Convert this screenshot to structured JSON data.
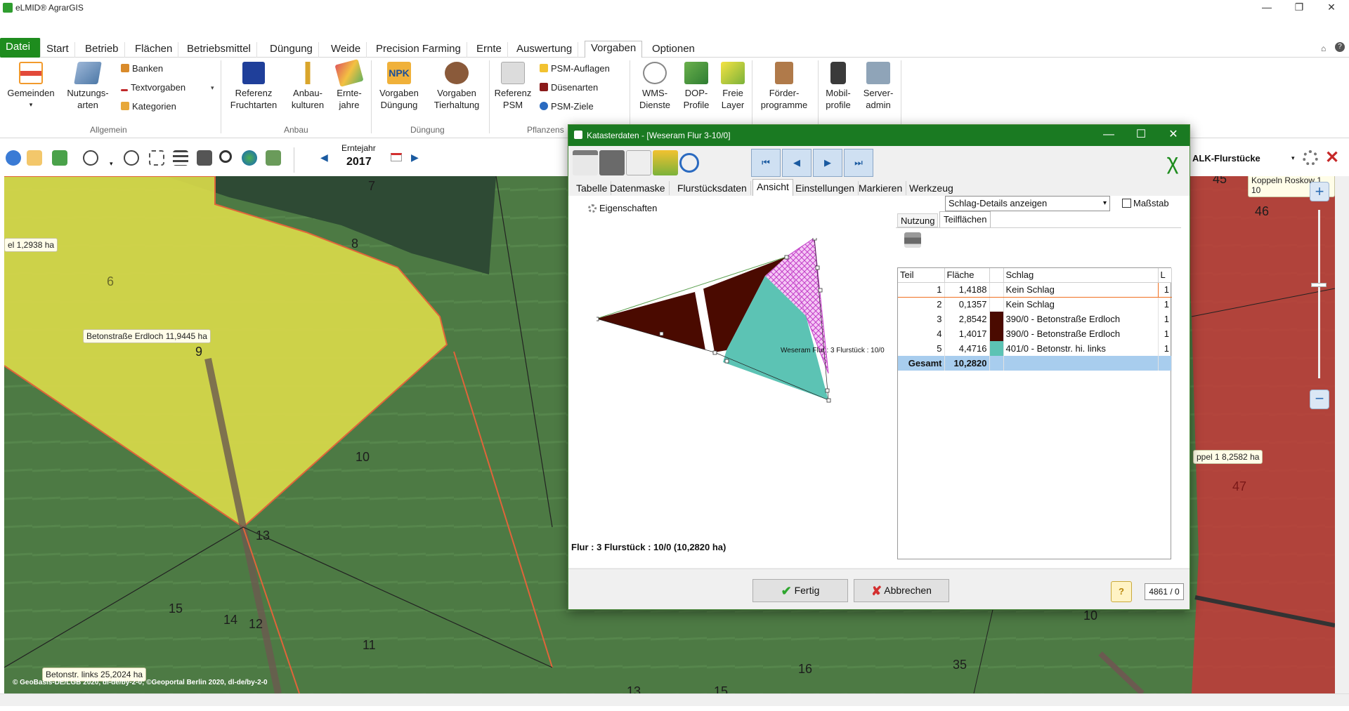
{
  "app": {
    "title": "eLMID® AgrarGIS"
  },
  "menu": {
    "tabs": [
      "Datei",
      "Start",
      "Betrieb",
      "Flächen",
      "Betriebsmittel",
      "Düngung",
      "Weide",
      "Precision Farming",
      "Ernte",
      "Auswertung",
      "Vorgaben",
      "Optionen"
    ],
    "active": "Vorgaben"
  },
  "ribbon": {
    "gemeinden": "Gemeinden",
    "nutzungsarten": [
      "Nutzungs-",
      "arten"
    ],
    "banken": "Banken",
    "textvorgaben": "Textvorgaben",
    "kategorien": "Kategorien",
    "group_allgemein": "Allgemein",
    "referenz_fruchtarten": [
      "Referenz",
      "Fruchtarten"
    ],
    "anbaukulturen": [
      "Anbau-",
      "kulturen"
    ],
    "erntejahre": [
      "Ernte-",
      "jahre"
    ],
    "group_anbau": "Anbau",
    "vorgaben_duengung": [
      "Vorgaben",
      "Düngung"
    ],
    "vorgaben_tierhaltung": [
      "Vorgaben",
      "Tierhaltung"
    ],
    "group_duengung": "Düngung",
    "referenz_psm": [
      "Referenz",
      "PSM"
    ],
    "psm_auflagen": "PSM-Auflagen",
    "duesenarten": "Düsenarten",
    "psm_ziele": "PSM-Ziele",
    "group_pflanzenschutz": "Pflanzens",
    "wms_dienste": [
      "WMS-",
      "Dienste"
    ],
    "dop_profile": [
      "DOP-",
      "Profile"
    ],
    "freie_layer": [
      "Freie",
      "Layer"
    ],
    "foerderprogramme": [
      "Förder-",
      "programme"
    ],
    "mobilprofile": [
      "Mobil-",
      "profile"
    ],
    "serveradmin": [
      "Server-",
      "admin"
    ],
    "npk_badge": "NPK"
  },
  "toolbar": {
    "erntejahr_label": "Erntejahr",
    "erntejahr_value": "2017",
    "alk_label": "ALK-Flurstücke"
  },
  "map": {
    "labels": {
      "l1": "el 1,2938 ha",
      "l2": "Betonstraße Erdloch 11,9445 ha",
      "l3": "Betonstr. links 25,2024 ha",
      "l4": "ppel 1 8,2582 ha",
      "l5": "Koppeln Roskow 1 10"
    },
    "numbers": [
      "7",
      "8",
      "9",
      "10",
      "13",
      "15",
      "14",
      "12",
      "11",
      "16",
      "10",
      "35",
      "46",
      "47",
      "45",
      "13",
      "15",
      "6"
    ],
    "copyright": "© GeoBasis-DE/LGB 2020, dl-de/by-2-0; ©Geoportal Berlin 2020, dl-de/by-2-0"
  },
  "dialog": {
    "title": "Katasterdaten - [Weseram  Flur 3-10/0]",
    "tabs": [
      "Tabelle",
      "Datenmaske",
      "Flurstücksdaten",
      "Ansicht",
      "Einstellungen",
      "Markieren",
      "Werkzeug"
    ],
    "active_tab": "Ansicht",
    "eigenschaften": "Eigenschaften",
    "view_select": "Schlag-Details anzeigen",
    "massstab": "Maßstab",
    "subtabs": [
      "Nutzung",
      "Teilflächen"
    ],
    "active_subtab": "Teilflächen",
    "polygon_label": "Weseram Flur : 3 Flurstück : 10/0",
    "table": {
      "headers": [
        "Teil",
        "Fläche",
        "",
        "Schlag",
        "L"
      ],
      "rows": [
        {
          "teil": "1",
          "flaeche": "1,4188",
          "color": "#ffffff",
          "schlag": "Kein Schlag",
          "l": "1"
        },
        {
          "teil": "2",
          "flaeche": "0,1357",
          "color": "#ffffff",
          "schlag": "Kein Schlag",
          "l": "1"
        },
        {
          "teil": "3",
          "flaeche": "2,8542",
          "color": "#4a0a00",
          "schlag": "390/0 - Betonstraße Erdloch",
          "l": "1"
        },
        {
          "teil": "4",
          "flaeche": "1,4017",
          "color": "#4a0a00",
          "schlag": "390/0 - Betonstraße Erdloch",
          "l": "1"
        },
        {
          "teil": "5",
          "flaeche": "4,4716",
          "color": "#5cc3b4",
          "schlag": "401/0 - Betonstr. hi. links",
          "l": "1"
        }
      ],
      "total_label": "Gesamt",
      "total_value": "10,2820"
    },
    "summary": "Flur : 3 Flurstück : 10/0 (10,2820 ha)",
    "btn_ok": "Fertig",
    "btn_cancel": "Abbrechen",
    "record": "4861 / 0"
  },
  "colors": {
    "green": "#1e8c1e",
    "dark_brown": "#4a0a00",
    "teal": "#5cc3b4",
    "pink": "#e59ce8"
  }
}
